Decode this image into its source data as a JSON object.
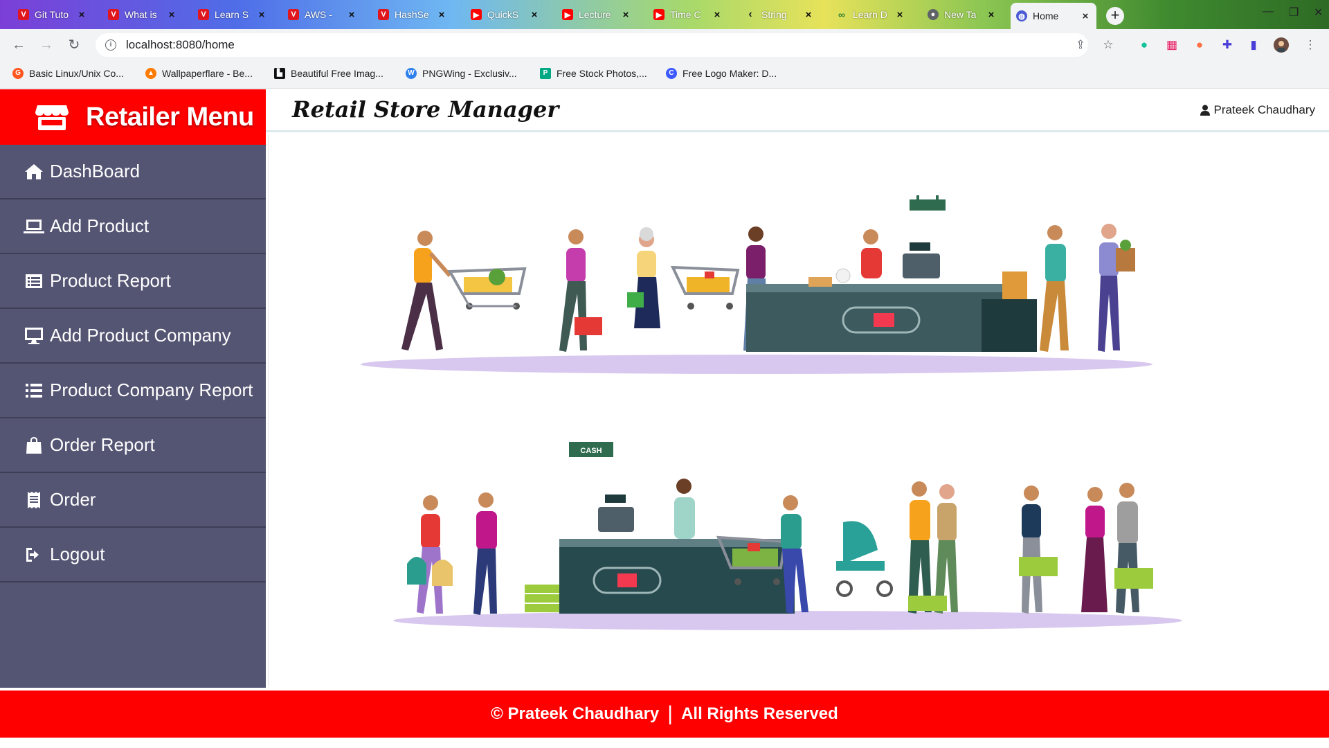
{
  "browser": {
    "tabs": [
      {
        "label": "Git Tuto",
        "icon": "tutorial-logo-icon",
        "color": "#e0161f"
      },
      {
        "label": "What is",
        "icon": "tutorial-logo-icon",
        "color": "#e0161f"
      },
      {
        "label": "Learn S",
        "icon": "tutorial-logo-icon",
        "color": "#e0161f"
      },
      {
        "label": "AWS -",
        "icon": "tutorial-logo-icon",
        "color": "#e0161f"
      },
      {
        "label": "HashSe",
        "icon": "tutorial-logo-icon",
        "color": "#e0161f"
      },
      {
        "label": "QuickS",
        "icon": "youtube-icon",
        "color": "#ff0000"
      },
      {
        "label": "Lecture",
        "icon": "youtube-icon",
        "color": "#ff0000"
      },
      {
        "label": "Time C",
        "icon": "youtube-icon",
        "color": "#ff0000"
      },
      {
        "label": "String",
        "icon": "code-icon",
        "color": "#333333"
      },
      {
        "label": "Learn D",
        "icon": "infinity-icon",
        "color": "#2e7d32"
      },
      {
        "label": "New Ta",
        "icon": "chrome-icon",
        "color": "#5f6368"
      },
      {
        "label": "Home",
        "icon": "globe-icon",
        "color": "#4a5bd4"
      }
    ],
    "new_tab": "+",
    "url": "localhost:8080/home",
    "bookmarks": [
      {
        "label": "Basic Linux/Unix Co...",
        "color": "#ff5722"
      },
      {
        "label": "Wallpaperflare - Be...",
        "color": "#ff7a00"
      },
      {
        "label": "Beautiful Free Imag...",
        "color": "#111111"
      },
      {
        "label": "PNGWing - Exclusiv...",
        "color": "#2f80ed"
      },
      {
        "label": "Free Stock Photos,...",
        "color": "#00a884"
      },
      {
        "label": "Free Logo Maker: D...",
        "color": "#3d5afe"
      }
    ]
  },
  "sidebar": {
    "brand": "Retailer Menu",
    "items": [
      {
        "label": "DashBoard",
        "icon": "home-icon"
      },
      {
        "label": "Add Product",
        "icon": "laptop-icon"
      },
      {
        "label": "Product Report",
        "icon": "list-alt-icon"
      },
      {
        "label": "Add Product Company",
        "icon": "desktop-icon"
      },
      {
        "label": "Product Company Report",
        "icon": "list-icon"
      },
      {
        "label": "Order Report",
        "icon": "shopping-bag-icon"
      },
      {
        "label": "Order",
        "icon": "receipt-icon"
      },
      {
        "label": "Logout",
        "icon": "logout-icon"
      }
    ]
  },
  "header": {
    "title": "Retail Store Manager",
    "user": "Prateek Chaudhary"
  },
  "content": {
    "illustration_sign": "CASH"
  },
  "footer": {
    "copyright": "© Prateek Chaudhary",
    "separator": "|",
    "rights": "All Rights Reserved"
  },
  "colors": {
    "brand_red": "#ff0000",
    "sidebar_bg": "#545473",
    "floor_lavender": "#d8c8ef"
  }
}
